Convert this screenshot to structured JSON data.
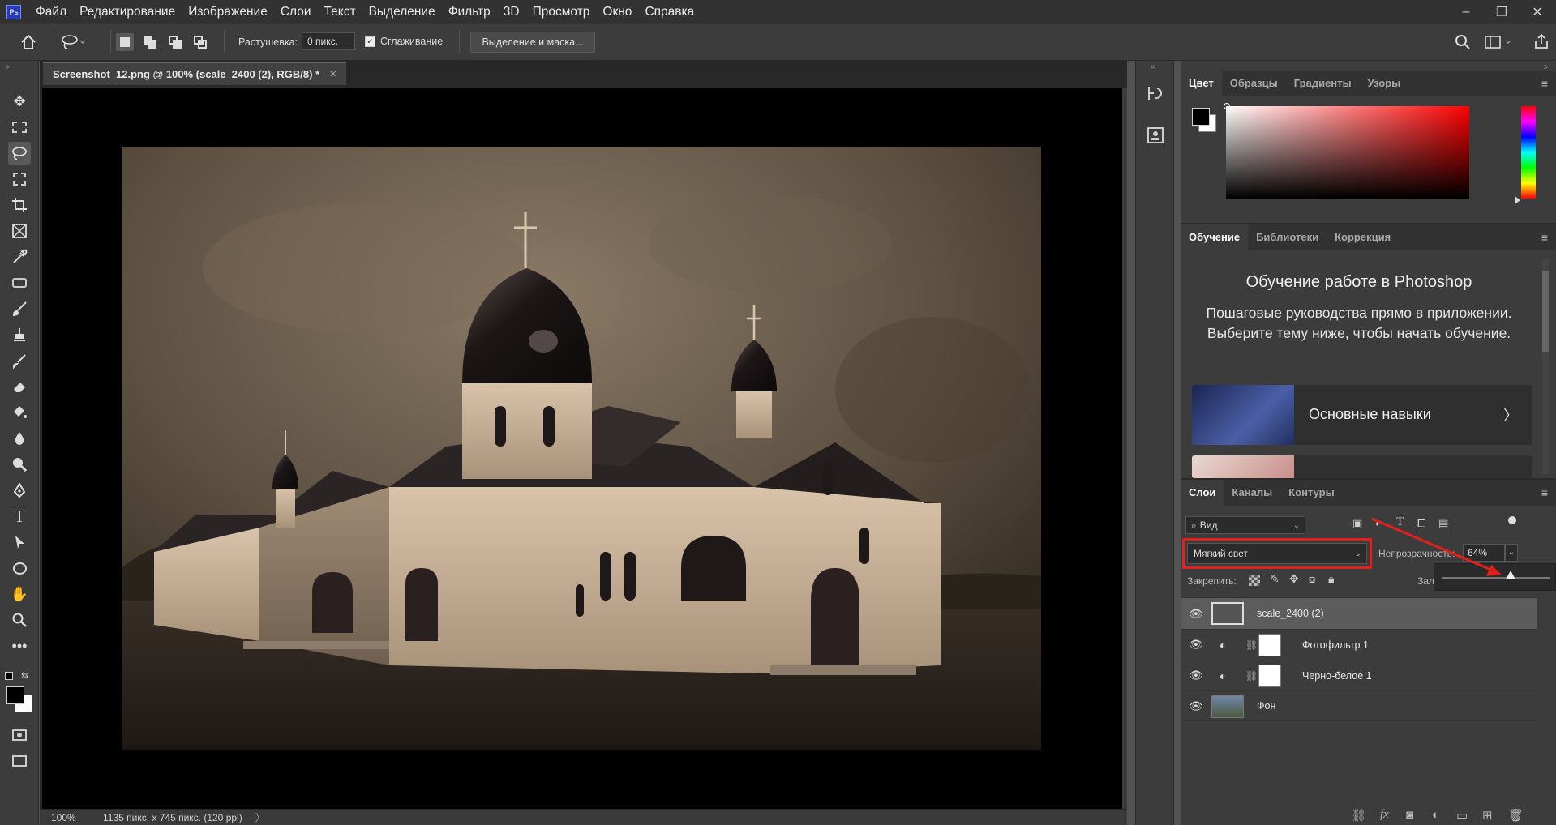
{
  "menubar": {
    "logo": "Ps",
    "items": [
      "Файл",
      "Редактирование",
      "Изображение",
      "Слои",
      "Текст",
      "Выделение",
      "Фильтр",
      "3D",
      "Просмотр",
      "Окно",
      "Справка"
    ],
    "window_controls": [
      "–",
      "❐",
      "✕"
    ]
  },
  "options": {
    "feather_label": "Растушевка:",
    "feather_value": "0 пикс.",
    "antialias_label": "Сглаживание",
    "select_mask_button": "Выделение и маска..."
  },
  "document": {
    "tab_title": "Screenshot_12.png @ 100% (scale_2400 (2), RGB/8) *",
    "tab_close": "✕",
    "zoom": "100%",
    "info": "1135 пикс. x 745 пикс. (120 ppi)",
    "status_arrow": "〉"
  },
  "color_panel": {
    "tabs": [
      "Цвет",
      "Образцы",
      "Градиенты",
      "Узоры"
    ],
    "foreground": "#000000",
    "background": "#ffffff"
  },
  "learn_panel": {
    "tabs": [
      "Обучение",
      "Библиотеки",
      "Коррекция"
    ],
    "title": "Обучение работе в Photoshop",
    "description": "Пошаговые руководства прямо в приложении. Выберите тему ниже, чтобы начать обучение.",
    "card_label": "Основные навыки",
    "card_arrow": "〉"
  },
  "layers_panel": {
    "tabs": [
      "Слои",
      "Каналы",
      "Контуры"
    ],
    "filter_value": "Вид",
    "blend_mode": "Мягкий свет",
    "opacity_label": "Непрозрачность:",
    "opacity_value": "64%",
    "lock_label": "Закрепить:",
    "fill_label": "Зал",
    "opacity_fraction": 0.64,
    "layers": [
      {
        "name": "scale_2400 (2)"
      },
      {
        "name": "Фотофильтр 1"
      },
      {
        "name": "Черно-белое 1"
      },
      {
        "name": "Фон"
      }
    ],
    "footer_icons": [
      "link-icon",
      "fx-icon",
      "mask-icon",
      "adjustment-icon",
      "group-icon",
      "new-layer-icon",
      "trash-icon"
    ]
  },
  "colors": {
    "highlight_box": "#e0201a",
    "annotation_arrow": "#e0201a"
  }
}
